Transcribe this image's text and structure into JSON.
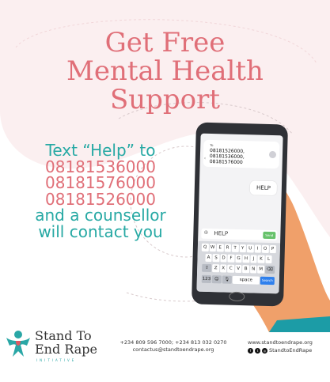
{
  "headline": {
    "line1": "Get Free",
    "line2": "Mental Health",
    "line3": "Support"
  },
  "cta": {
    "line1": "Text “Help” to",
    "numbers": [
      "08181536000",
      "08181576000",
      "08181526000"
    ],
    "line5": "and a counsellor",
    "line6": "will contact you"
  },
  "phone": {
    "to_label": "To",
    "recipients": "08181526000,\n08181536000,\n08181576000",
    "message_bubble": "HELP",
    "input_text": "HELP",
    "send_label": "Send",
    "keyboard": {
      "row1": [
        "Q",
        "W",
        "E",
        "R",
        "T",
        "Y",
        "U",
        "I",
        "O",
        "P"
      ],
      "row2": [
        "A",
        "S",
        "D",
        "F",
        "G",
        "H",
        "J",
        "K",
        "L"
      ],
      "row3": [
        "Z",
        "X",
        "C",
        "V",
        "B",
        "N",
        "M"
      ],
      "key_123": "123",
      "space": "space",
      "search": "Search"
    }
  },
  "footer": {
    "brand_line1": "Stand To",
    "brand_line2": "End Rape",
    "tagline": "INITIATIVE",
    "phones": "+234 809 596 7000; +234 813 032 0270",
    "email": "contactus@standtoendrape.org",
    "website": "www.standtoendrape.org",
    "handle": "StandtoEndRape"
  },
  "colors": {
    "pink": "#e06f78",
    "teal": "#27a9a4"
  }
}
